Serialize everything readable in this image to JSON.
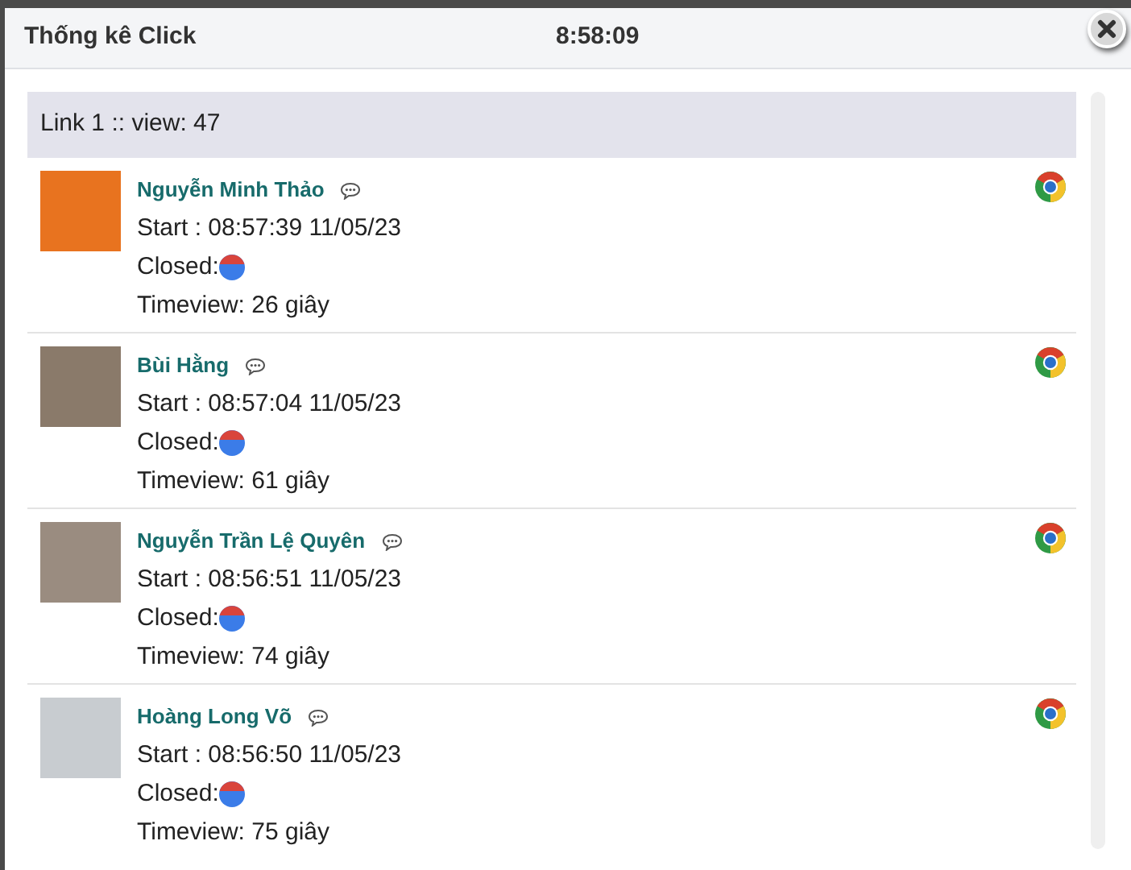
{
  "dialog": {
    "title": "Thống kê Click",
    "clock": "8:58:09"
  },
  "link_header": "Link 1 :: view: 47",
  "visits": [
    {
      "name": "Nguyễn Minh Thảo",
      "start": "Start : 08:57:39 11/05/23",
      "closed_label": "Closed:",
      "timeview": "Timeview: 26 giây"
    },
    {
      "name": "Bùi Hằng",
      "start": "Start : 08:57:04 11/05/23",
      "closed_label": "Closed:",
      "timeview": "Timeview: 61 giây"
    },
    {
      "name": "Nguyễn Trần Lệ Quyên",
      "start": "Start : 08:56:51 11/05/23",
      "closed_label": "Closed:",
      "timeview": "Timeview: 74 giây"
    },
    {
      "name": "Hoàng Long Võ",
      "start": "Start : 08:56:50 11/05/23",
      "closed_label": "Closed:",
      "timeview": "Timeview: 75 giây"
    }
  ]
}
